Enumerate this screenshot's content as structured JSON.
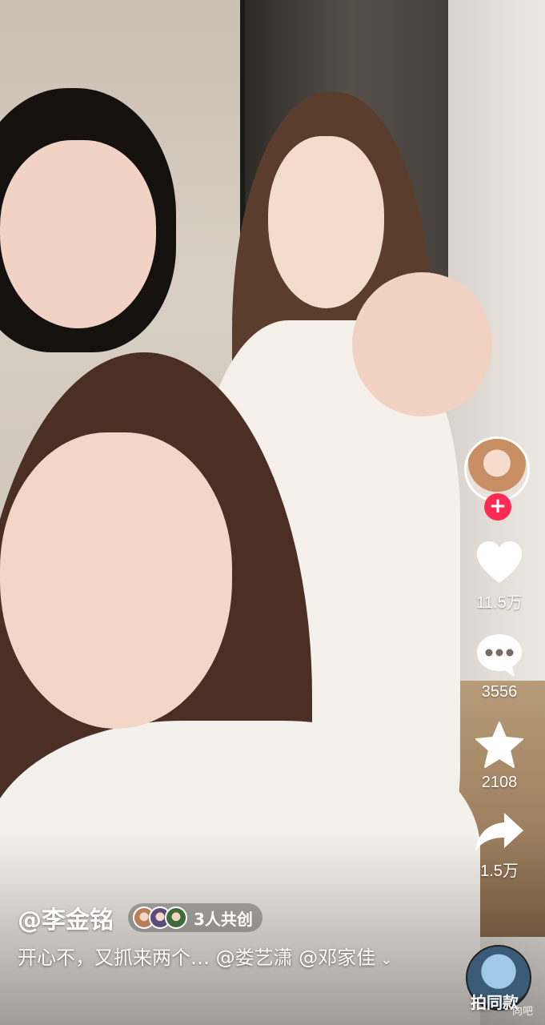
{
  "author": {
    "handle": "@李金铭"
  },
  "collab": {
    "label": "3人共创"
  },
  "caption": {
    "text": "开心不，又抓来两个… @娄艺潇 @邓家佳",
    "more_icon": "chevron-down-icon"
  },
  "actions": {
    "like_count": "11.5万",
    "comment_count": "3556",
    "favorite_count": "2108",
    "share_count": "1.5万"
  },
  "follow": {
    "label": "+"
  },
  "music": {
    "label": "拍同款"
  },
  "watermark": {
    "text": "向吧"
  },
  "colors": {
    "accent": "#fe2c55",
    "icon": "#ffffff"
  }
}
